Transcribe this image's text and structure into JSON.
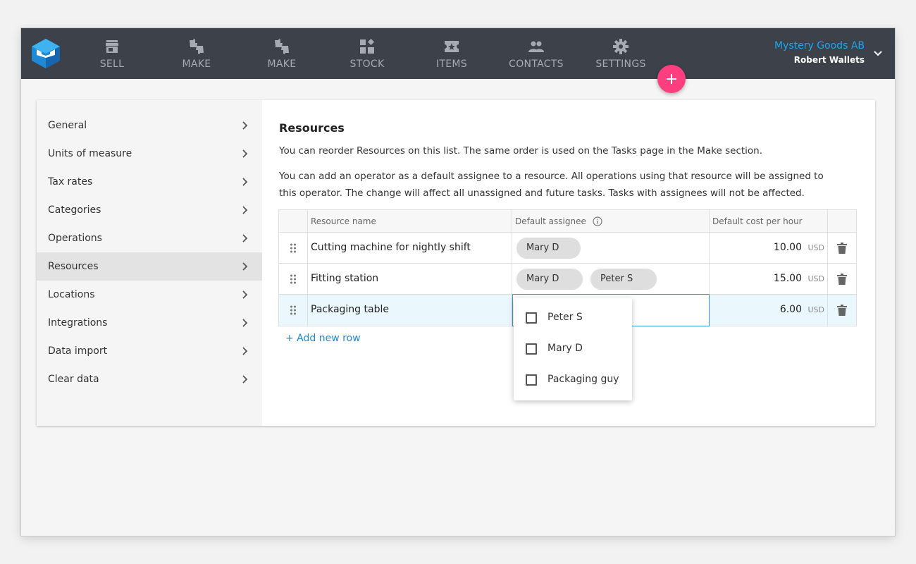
{
  "app": {
    "company_name": "Mystery Goods AB",
    "user_name": "Robert Wallets",
    "accent_color": "#1aa7f0",
    "fab_color": "#ff3e7f"
  },
  "nav": {
    "items": [
      {
        "label": "SELL",
        "icon": "shop-icon"
      },
      {
        "label": "MAKE",
        "icon": "thumbs-icon"
      },
      {
        "label": "MAKE",
        "icon": "thumbs-icon"
      },
      {
        "label": "STOCK",
        "icon": "blocks-icon"
      },
      {
        "label": "ITEMS",
        "icon": "ticket-icon"
      },
      {
        "label": "CONTACTS",
        "icon": "people-icon"
      },
      {
        "label": "SETTINGS",
        "icon": "gear-icon"
      }
    ]
  },
  "sidebar": {
    "items": [
      {
        "label": "General"
      },
      {
        "label": "Units of measure"
      },
      {
        "label": "Tax rates"
      },
      {
        "label": "Categories"
      },
      {
        "label": "Operations"
      },
      {
        "label": "Resources",
        "active": true
      },
      {
        "label": "Locations"
      },
      {
        "label": "Integrations"
      },
      {
        "label": "Data import"
      },
      {
        "label": "Clear data"
      }
    ]
  },
  "resources": {
    "title": "Resources",
    "description_1": "You can reorder Resources on this list. The same order is used on the Tasks page in the Make section.",
    "description_2": "You can add an operator as a default assignee to a resource. All operations using that resource will be assigned to this operator. The change will affect all unassigned and future tasks. Tasks with assignees will not be affected.",
    "columns": {
      "name": "Resource name",
      "assignee": "Default assignee",
      "cost": "Default cost per hour"
    },
    "rows": [
      {
        "name": "Cutting machine for nightly shift",
        "assignees": [
          "Mary D"
        ],
        "cost": "10.00",
        "currency": "USD"
      },
      {
        "name": "Fitting station",
        "assignees": [
          "Mary D",
          "Peter S"
        ],
        "cost": "15.00",
        "currency": "USD"
      },
      {
        "name": "Packaging table",
        "assignees": [],
        "cost": "6.00",
        "currency": "USD"
      }
    ],
    "add_row_label": "+ Add new row"
  },
  "assignee_dropdown": {
    "options": [
      {
        "label": "Peter S",
        "checked": false
      },
      {
        "label": "Mary D",
        "checked": false
      },
      {
        "label": "Packaging guy",
        "checked": false
      }
    ]
  }
}
